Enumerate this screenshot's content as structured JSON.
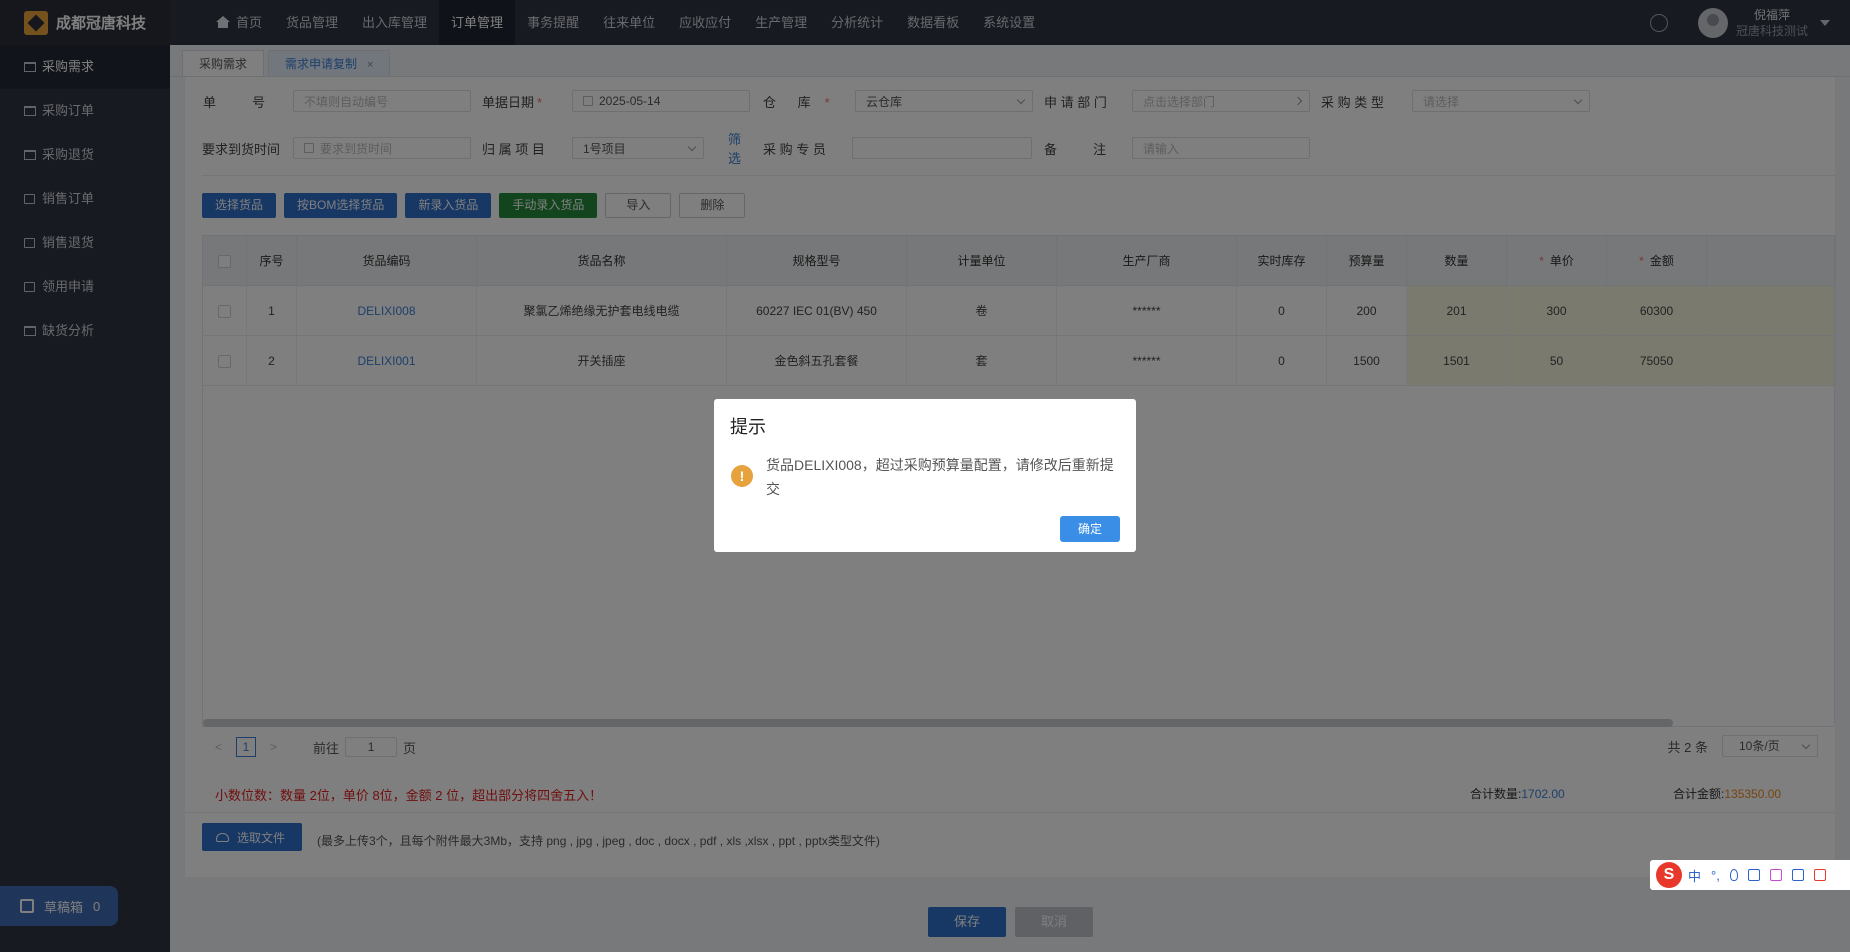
{
  "app": {
    "logo_text": "成都冠唐科技",
    "user_name": "倪福萍",
    "user_org": "冠唐科技测试"
  },
  "topnav": [
    {
      "label": "首页"
    },
    {
      "label": "货品管理"
    },
    {
      "label": "出入库管理"
    },
    {
      "label": "订单管理"
    },
    {
      "label": "事务提醒"
    },
    {
      "label": "往来单位"
    },
    {
      "label": "应收应付"
    },
    {
      "label": "生产管理"
    },
    {
      "label": "分析统计"
    },
    {
      "label": "数据看板"
    },
    {
      "label": "系统设置"
    }
  ],
  "sidebar": {
    "items": [
      {
        "label": "采购需求"
      },
      {
        "label": "采购订单"
      },
      {
        "label": "采购退货"
      },
      {
        "label": "销售订单"
      },
      {
        "label": "销售退货"
      },
      {
        "label": "领用申请"
      },
      {
        "label": "缺货分析"
      }
    ],
    "draft_label": "草稿箱",
    "draft_count": "0"
  },
  "tabs": [
    {
      "label": "采购需求"
    },
    {
      "label": "需求申请复制",
      "close": "×"
    }
  ],
  "form": {
    "doc_no_label": "单          号",
    "doc_no_placeholder": "不填则自动编号",
    "date_label": "单据日期",
    "date_value": "2025-05-14",
    "warehouse_label": "仓      库",
    "warehouse_value": "云仓库",
    "dept_label": "申 请 部 门",
    "dept_placeholder": "点击选择部门",
    "ptype_label": "采 购 类 型",
    "ptype_placeholder": "请选择",
    "arrival_label": "要求到货时间",
    "arrival_placeholder": "要求到货时间",
    "project_label": "归 属 项 目",
    "project_value": "1号项目",
    "filter_link": "筛选",
    "buyer_label": "采 购 专 员",
    "remark_label": "备          注",
    "remark_placeholder": "请输入",
    "required_mark": "*"
  },
  "toolbar": {
    "select_goods": "选择货品",
    "bom_select": "按BOM选择货品",
    "new_goods": "新录入货品",
    "manual_goods": "手动录入货品",
    "import": "导入",
    "delete": "删除"
  },
  "table": {
    "headers": [
      "序号",
      "货品编码",
      "货品名称",
      "规格型号",
      "计量单位",
      "生产厂商",
      "实时库存",
      "预算量",
      "数量",
      "单价",
      "金额"
    ],
    "required_mark": "*",
    "rows": [
      {
        "no": "1",
        "code": "DELIXI008",
        "name": "聚氯乙烯绝缘无护套电线电缆",
        "spec": "60227 IEC 01(BV) 450",
        "unit": "卷",
        "maker": "******",
        "stock": "0",
        "budget": "200",
        "qty": "201",
        "price": "300",
        "amount": "60300"
      },
      {
        "no": "2",
        "code": "DELIXI001",
        "name": "开关插座",
        "spec": "金色斜五孔套餐",
        "unit": "套",
        "maker": "******",
        "stock": "0",
        "budget": "1500",
        "qty": "1501",
        "price": "50",
        "amount": "75050"
      }
    ]
  },
  "pager": {
    "prev": "<",
    "next": ">",
    "current": "1",
    "goto_prefix": "前往",
    "goto_value": "1",
    "goto_suffix": "页",
    "total": "共 2 条",
    "page_size": "10条/页"
  },
  "summary": {
    "notice": "小数位数：数量 2位，单价 8位，金额 2 位，超出部分将四舍五入！",
    "qty_label": "合计数量:",
    "qty_value": "1702.00",
    "amount_label": "合计金额:",
    "amount_value": "135350.00"
  },
  "upload": {
    "button": "选取文件",
    "hint": "(最多上传3个，且每个附件最大3Mb，支持 png , jpg , jpeg , doc , docx , pdf , xls ,xlsx , ppt , pptx类型文件)"
  },
  "footer": {
    "save": "保存",
    "cancel": "取消"
  },
  "modal": {
    "title": "提示",
    "message": "货品DELIXI008，超过采购预算量配置，请修改后重新提交",
    "ok": "确定",
    "icon": "!"
  },
  "ime": {
    "logo": "S",
    "lang": "中",
    "punct": "°,"
  },
  "colors": {
    "primary": "#2f6ec8",
    "sidebar": "#2f3441",
    "warning": "#e6a23c",
    "danger": "#e02020",
    "highlight": "#f7f5df"
  }
}
